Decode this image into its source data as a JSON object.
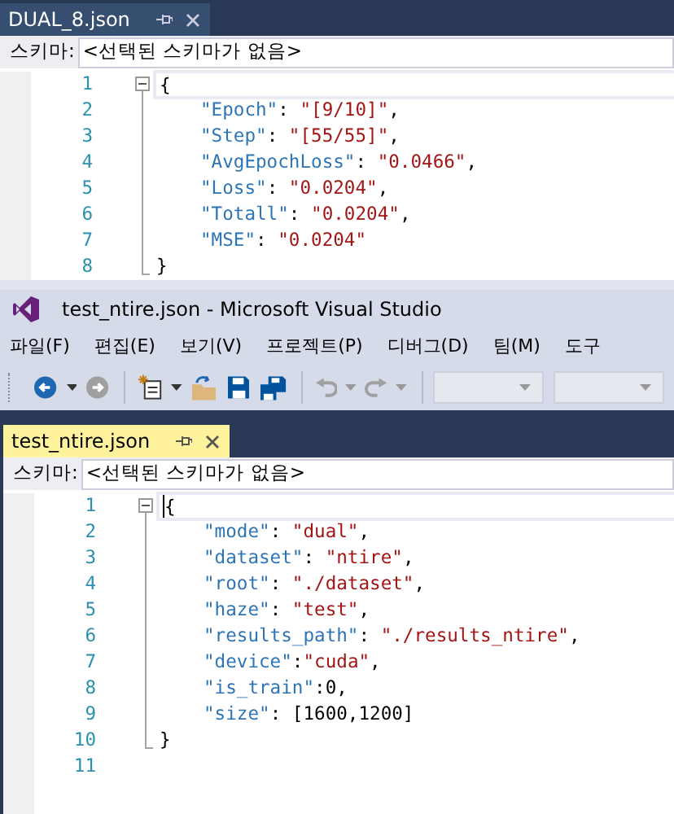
{
  "top_document": {
    "tab": {
      "title": "DUAL_8.json",
      "selected": false
    },
    "schema_bar": {
      "label": "스키마:",
      "value": "<선택된 스키마가 없음>"
    },
    "editor": {
      "lines": [
        {
          "number": "1",
          "kind": "open",
          "current": true,
          "cursor": false,
          "tokens": [
            {
              "kind": "punct",
              "text": "{"
            }
          ]
        },
        {
          "number": "2",
          "kind": "member",
          "current": false,
          "cursor": false,
          "tokens": [
            {
              "kind": "key",
              "text": "\"Epoch\""
            },
            {
              "kind": "punct",
              "text": ": "
            },
            {
              "kind": "string",
              "text": "\"[9/10]\""
            },
            {
              "kind": "punct",
              "text": ","
            }
          ]
        },
        {
          "number": "3",
          "kind": "member",
          "current": false,
          "cursor": false,
          "tokens": [
            {
              "kind": "key",
              "text": "\"Step\""
            },
            {
              "kind": "punct",
              "text": ": "
            },
            {
              "kind": "string",
              "text": "\"[55/55]\""
            },
            {
              "kind": "punct",
              "text": ","
            }
          ]
        },
        {
          "number": "4",
          "kind": "member",
          "current": false,
          "cursor": false,
          "tokens": [
            {
              "kind": "key",
              "text": "\"AvgEpochLoss\""
            },
            {
              "kind": "punct",
              "text": ": "
            },
            {
              "kind": "string",
              "text": "\"0.0466\""
            },
            {
              "kind": "punct",
              "text": ","
            }
          ]
        },
        {
          "number": "5",
          "kind": "member",
          "current": false,
          "cursor": false,
          "tokens": [
            {
              "kind": "key",
              "text": "\"Loss\""
            },
            {
              "kind": "punct",
              "text": ": "
            },
            {
              "kind": "string",
              "text": "\"0.0204\""
            },
            {
              "kind": "punct",
              "text": ","
            }
          ]
        },
        {
          "number": "6",
          "kind": "member",
          "current": false,
          "cursor": false,
          "tokens": [
            {
              "kind": "key",
              "text": "\"Totall\""
            },
            {
              "kind": "punct",
              "text": ": "
            },
            {
              "kind": "string",
              "text": "\"0.0204\""
            },
            {
              "kind": "punct",
              "text": ","
            }
          ]
        },
        {
          "number": "7",
          "kind": "member",
          "current": false,
          "cursor": false,
          "tokens": [
            {
              "kind": "key",
              "text": "\"MSE\""
            },
            {
              "kind": "punct",
              "text": ": "
            },
            {
              "kind": "string",
              "text": "\"0.0204\""
            }
          ]
        },
        {
          "number": "8",
          "kind": "close",
          "current": false,
          "cursor": false,
          "tokens": [
            {
              "kind": "punct",
              "text": "}"
            }
          ]
        }
      ]
    }
  },
  "window": {
    "title": "test_ntire.json - Microsoft Visual Studio"
  },
  "menu": [
    {
      "label": "파일(F)"
    },
    {
      "label": "편집(E)"
    },
    {
      "label": "보기(V)"
    },
    {
      "label": "프로젝트(P)"
    },
    {
      "label": "디버그(D)"
    },
    {
      "label": "팀(M)"
    },
    {
      "label": "도구"
    }
  ],
  "toolbar": [
    {
      "kind": "back",
      "disabled": false
    },
    {
      "kind": "caret",
      "disabled": false
    },
    {
      "kind": "forward",
      "disabled": true
    },
    {
      "kind": "separator"
    },
    {
      "kind": "new",
      "disabled": false
    },
    {
      "kind": "caret",
      "disabled": false
    },
    {
      "kind": "open",
      "disabled": false
    },
    {
      "kind": "save",
      "disabled": false
    },
    {
      "kind": "saveall",
      "disabled": false
    },
    {
      "kind": "separator"
    },
    {
      "kind": "undo",
      "disabled": true
    },
    {
      "kind": "caret",
      "disabled": true
    },
    {
      "kind": "redo",
      "disabled": true
    },
    {
      "kind": "caret",
      "disabled": true
    },
    {
      "kind": "separator"
    },
    {
      "kind": "combo",
      "disabled": true
    },
    {
      "kind": "combo",
      "disabled": true
    }
  ],
  "document": {
    "tab": {
      "title": "test_ntire.json",
      "selected": true
    },
    "schema_bar": {
      "label": "스키마:",
      "value": "<선택된 스키마가 없음>"
    },
    "editor": {
      "lines": [
        {
          "number": "1",
          "kind": "open",
          "current": true,
          "cursor": true,
          "tokens": [
            {
              "kind": "punct",
              "text": "{"
            }
          ]
        },
        {
          "number": "2",
          "kind": "member",
          "current": false,
          "cursor": false,
          "tokens": [
            {
              "kind": "key",
              "text": "\"mode\""
            },
            {
              "kind": "punct",
              "text": ": "
            },
            {
              "kind": "string",
              "text": "\"dual\""
            },
            {
              "kind": "punct",
              "text": ","
            }
          ]
        },
        {
          "number": "3",
          "kind": "member",
          "current": false,
          "cursor": false,
          "tokens": [
            {
              "kind": "key",
              "text": "\"dataset\""
            },
            {
              "kind": "punct",
              "text": ": "
            },
            {
              "kind": "string",
              "text": "\"ntire\""
            },
            {
              "kind": "punct",
              "text": ","
            }
          ]
        },
        {
          "number": "4",
          "kind": "member",
          "current": false,
          "cursor": false,
          "tokens": [
            {
              "kind": "key",
              "text": "\"root\""
            },
            {
              "kind": "punct",
              "text": ": "
            },
            {
              "kind": "string",
              "text": "\"./dataset\""
            },
            {
              "kind": "punct",
              "text": ","
            }
          ]
        },
        {
          "number": "5",
          "kind": "member",
          "current": false,
          "cursor": false,
          "tokens": [
            {
              "kind": "key",
              "text": "\"haze\""
            },
            {
              "kind": "punct",
              "text": ": "
            },
            {
              "kind": "string",
              "text": "\"test\""
            },
            {
              "kind": "punct",
              "text": ","
            }
          ]
        },
        {
          "number": "6",
          "kind": "member",
          "current": false,
          "cursor": false,
          "tokens": [
            {
              "kind": "key",
              "text": "\"results_path\""
            },
            {
              "kind": "punct",
              "text": ": "
            },
            {
              "kind": "string",
              "text": "\"./results_ntire\""
            },
            {
              "kind": "punct",
              "text": ","
            }
          ]
        },
        {
          "number": "7",
          "kind": "member",
          "current": false,
          "cursor": false,
          "tokens": [
            {
              "kind": "key",
              "text": "\"device\""
            },
            {
              "kind": "punct",
              "text": ":"
            },
            {
              "kind": "string",
              "text": "\"cuda\""
            },
            {
              "kind": "punct",
              "text": ","
            }
          ]
        },
        {
          "number": "8",
          "kind": "member",
          "current": false,
          "cursor": false,
          "tokens": [
            {
              "kind": "key",
              "text": "\"is_train\""
            },
            {
              "kind": "punct",
              "text": ":0,"
            }
          ]
        },
        {
          "number": "9",
          "kind": "member",
          "current": false,
          "cursor": false,
          "tokens": [
            {
              "kind": "key",
              "text": "\"size\""
            },
            {
              "kind": "punct",
              "text": ": [1600,1200]"
            }
          ]
        },
        {
          "number": "10",
          "kind": "close",
          "current": false,
          "cursor": false,
          "tokens": [
            {
              "kind": "punct",
              "text": "}"
            }
          ]
        },
        {
          "number": "11",
          "kind": "blank",
          "current": false,
          "cursor": false
        }
      ]
    }
  }
}
